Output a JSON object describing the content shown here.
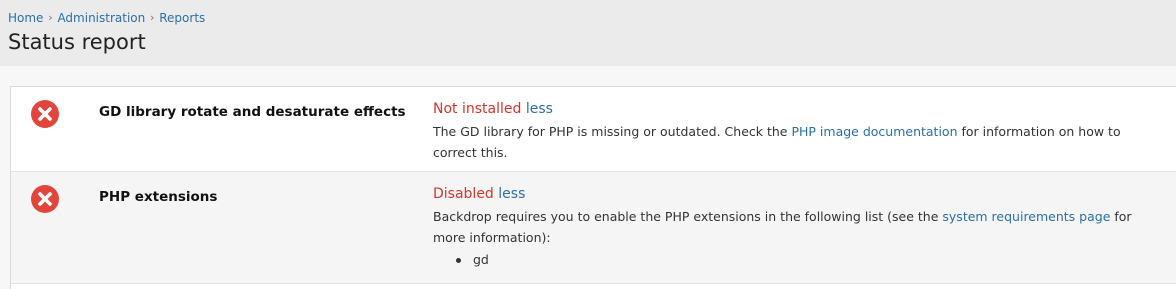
{
  "breadcrumb": {
    "items": [
      "Home",
      "Administration",
      "Reports"
    ]
  },
  "page": {
    "title": "Status report"
  },
  "colors": {
    "error": "#e2453c",
    "link": "#2a6fa8",
    "status_text": "#d4342a"
  },
  "rows": [
    {
      "icon": "error-x-icon",
      "title": "GD library rotate and desaturate effects",
      "status": "Not installed",
      "toggle": "less",
      "desc_before": "The GD library for PHP is missing or outdated. Check the ",
      "desc_link": "PHP image documentation",
      "desc_after": " for information on how to correct this."
    },
    {
      "icon": "error-x-icon",
      "title": "PHP extensions",
      "status": "Disabled",
      "toggle": "less",
      "desc_before": "Backdrop requires you to enable the PHP extensions in the following list (see the ",
      "desc_link": "system requirements page",
      "desc_after": " for more information):",
      "extensions": [
        "gd"
      ]
    }
  ]
}
